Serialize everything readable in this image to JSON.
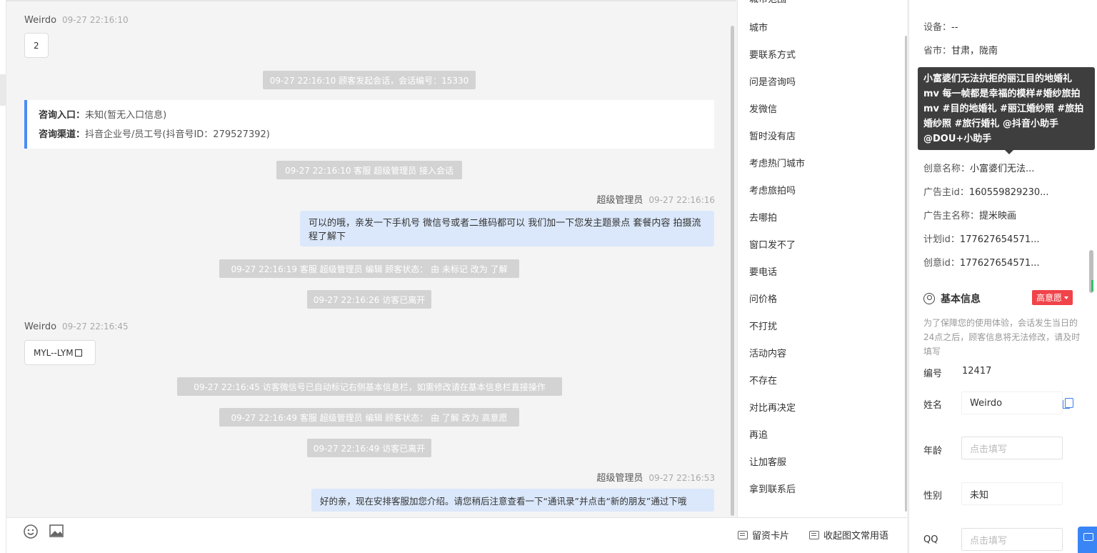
{
  "chat": {
    "msg1": {
      "sender": "Weirdo",
      "time": "09-27 22:16:10",
      "text": "2"
    },
    "sys1": "09-27 22:16:10 顾客发起会话，会话编号：15330",
    "info_card": {
      "entry_label": "咨询入口：",
      "entry_value": "未知(暂无入口信息)",
      "channel_label": "咨询渠道：",
      "channel_value": "抖音企业号/员工号(抖音号ID：279527392)"
    },
    "sys2": "09-27 22:16:10 客服 超级管理员 接入会话",
    "msg2": {
      "sender": "超级管理员",
      "time": "09-27 22:16:16",
      "text": "可以的哦，亲发一下手机号 微信号或者二维码都可以 我们加一下您发主题景点 套餐内容 拍摄流程了解下"
    },
    "sys3": "09-27 22:16:19 客服 超级管理员 编辑 顾客状态： 由 未标记 改为 了解",
    "sys4": "09-27 22:16:26 访客已离开",
    "msg3": {
      "sender": "Weirdo",
      "time": "09-27 22:16:45",
      "text": "MYL--LYM"
    },
    "sys5": "09-27 22:16:45 访客微信号已自动标记右侧基本信息栏，如需修改请在基本信息栏直接操作",
    "sys6": "09-27 22:16:49 客服 超级管理员 编辑 顾客状态： 由 了解 改为 高意愿",
    "sys7": "09-27 22:16:49 访客已离开",
    "msg4": {
      "sender": "超级管理员",
      "time": "09-27 22:16:53",
      "text": "好的亲，现在安排客服加您介绍。请您稍后注意查看一下“通讯录”并点击“新的朋友”通过下哦"
    }
  },
  "toolbar": {
    "emoji_icon": "smile-icon",
    "image_icon": "image-icon",
    "card_label": "留资卡片",
    "collapse_label": "收起图文常用语"
  },
  "quick_replies": [
    "城市",
    "要联系方式",
    "问是咨询吗",
    "发微信",
    "暂时没有店",
    "考虑热门城市",
    "考虑旅拍吗",
    "去哪拍",
    "窗口发不了",
    "要电话",
    "问价格",
    "不打扰",
    "活动内容",
    "不存在",
    "对比再决定",
    "再追",
    "让加客服",
    "拿到联系后"
  ],
  "source_info": {
    "device_label": "设备：",
    "device_value": "--",
    "province_label": "省市：",
    "province_value": "甘肃，陇南",
    "creative_name_label": "创意名称：",
    "creative_name_value": "小富婆们无法...",
    "advertiser_id_label": "广告主id：",
    "advertiser_id_value": "160559829230...",
    "advertiser_name_label": "广告主名称：",
    "advertiser_name_value": "提米映画",
    "plan_id_label": "计划id：",
    "plan_id_value": "177627654571...",
    "creative_id_label": "创意id：",
    "creative_id_value": "177627654571..."
  },
  "tooltip": "小富婆们无法抗拒的丽江目的地婚礼 mv 每一帧都是幸福的模样#婚纱旅拍 mv #目的地婚礼 #丽江婚纱照 #旅拍婚纱照 #旅行婚礼 @抖音小助手 @DOU+小助手",
  "basic_info": {
    "title": "基本信息",
    "intent_badge": "高意愿",
    "note": "为了保障您的使用体验，会话发生当日的24点之后，顾客信息将无法修改，请及时填写",
    "number_label": "编号",
    "number_value": "12417",
    "name_label": "姓名",
    "name_value": "Weirdo",
    "age_label": "年龄",
    "age_placeholder": "点击填写",
    "gender_label": "性别",
    "gender_value": "未知",
    "qq_label": "QQ",
    "qq_placeholder": "点击填写"
  },
  "colors": {
    "accent": "#4b8cf5",
    "badge": "#f0434a",
    "bubble_blue": "#dbe8fb"
  }
}
